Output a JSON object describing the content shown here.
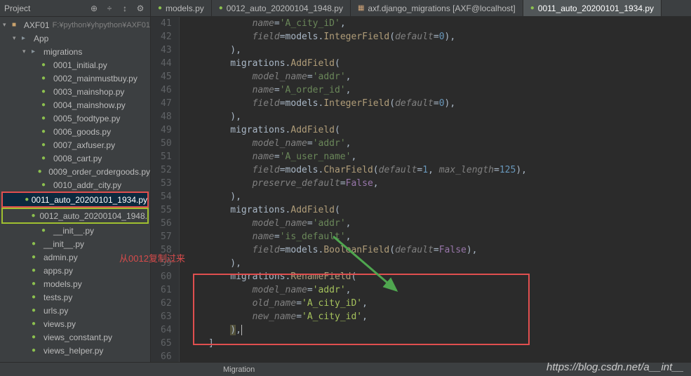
{
  "project_header": {
    "title": "Project",
    "icons": [
      "target",
      "divide",
      "collapse",
      "gear"
    ]
  },
  "tabs": [
    {
      "label": "models.py",
      "type": "py",
      "active": false
    },
    {
      "label": "0012_auto_20200104_1948.py",
      "type": "py",
      "active": false
    },
    {
      "label": "axf.django_migrations [AXF@localhost]",
      "type": "db",
      "active": false
    },
    {
      "label": "0011_auto_20200101_1934.py",
      "type": "py",
      "active": true
    }
  ],
  "tree": {
    "root": {
      "name": "AXF01",
      "path": "F:¥python¥yhpython¥AXF01"
    },
    "nodes": [
      {
        "indent": 0,
        "name": "AXF01",
        "sub": "F:¥python¥yhpython¥AXF01",
        "icon": "module",
        "expanded": true
      },
      {
        "indent": 1,
        "name": "App",
        "icon": "folder",
        "expanded": true
      },
      {
        "indent": 2,
        "name": "migrations",
        "icon": "folder",
        "expanded": true
      },
      {
        "indent": 3,
        "name": "0001_initial.py",
        "icon": "py"
      },
      {
        "indent": 3,
        "name": "0002_mainmustbuy.py",
        "icon": "py"
      },
      {
        "indent": 3,
        "name": "0003_mainshop.py",
        "icon": "py"
      },
      {
        "indent": 3,
        "name": "0004_mainshow.py",
        "icon": "py"
      },
      {
        "indent": 3,
        "name": "0005_foodtype.py",
        "icon": "py"
      },
      {
        "indent": 3,
        "name": "0006_goods.py",
        "icon": "py"
      },
      {
        "indent": 3,
        "name": "0007_axfuser.py",
        "icon": "py"
      },
      {
        "indent": 3,
        "name": "0008_cart.py",
        "icon": "py"
      },
      {
        "indent": 3,
        "name": "0009_order_ordergoods.py",
        "icon": "py"
      },
      {
        "indent": 3,
        "name": "0010_addr_city.py",
        "icon": "py"
      },
      {
        "indent": 3,
        "name": "0011_auto_20200101_1934.py",
        "icon": "py",
        "selected": true,
        "box": "red"
      },
      {
        "indent": 3,
        "name": "0012_auto_20200104_1948.",
        "icon": "py",
        "box": "green"
      },
      {
        "indent": 3,
        "name": "__init__.py",
        "icon": "py"
      },
      {
        "indent": 2,
        "name": "__init__.py",
        "icon": "py"
      },
      {
        "indent": 2,
        "name": "admin.py",
        "icon": "py"
      },
      {
        "indent": 2,
        "name": "apps.py",
        "icon": "py"
      },
      {
        "indent": 2,
        "name": "models.py",
        "icon": "py"
      },
      {
        "indent": 2,
        "name": "tests.py",
        "icon": "py"
      },
      {
        "indent": 2,
        "name": "urls.py",
        "icon": "py"
      },
      {
        "indent": 2,
        "name": "views.py",
        "icon": "py"
      },
      {
        "indent": 2,
        "name": "views_constant.py",
        "icon": "py"
      },
      {
        "indent": 2,
        "name": "views_helper.py",
        "icon": "py"
      }
    ]
  },
  "gutter": {
    "start": 41,
    "end": 66
  },
  "code_lines": [
    {
      "n": 41,
      "html": "            <span class='param'>name</span>=<span class='str'>'A_city_iD'</span>,"
    },
    {
      "n": 42,
      "html": "            <span class='param'>field</span>=models.<span class='fn'>IntegerField</span>(<span class='param'>default</span>=<span class='num'>0</span>),"
    },
    {
      "n": 43,
      "html": "        ),"
    },
    {
      "n": 44,
      "html": "        migrations.<span class='fn'>AddField</span>("
    },
    {
      "n": 45,
      "html": "            <span class='param'>model_name</span>=<span class='str'>'addr'</span>,"
    },
    {
      "n": 46,
      "html": "            <span class='param'>name</span>=<span class='str'>'A_order_id'</span>,"
    },
    {
      "n": 47,
      "html": "            <span class='param'>field</span>=models.<span class='fn'>IntegerField</span>(<span class='param'>default</span>=<span class='num'>0</span>),"
    },
    {
      "n": 48,
      "html": "        ),"
    },
    {
      "n": 49,
      "html": "        migrations.<span class='fn'>AddField</span>("
    },
    {
      "n": 50,
      "html": "            <span class='param'>model_name</span>=<span class='str'>'addr'</span>,"
    },
    {
      "n": 51,
      "html": "            <span class='param'>name</span>=<span class='str'>'A_user_name'</span>,"
    },
    {
      "n": 52,
      "html": "            <span class='param'>field</span>=models.<span class='fn'>CharField</span>(<span class='param'>default</span>=<span class='num'>1</span>, <span class='param'>max_length</span>=<span class='num'>125</span>),"
    },
    {
      "n": 53,
      "html": "            <span class='param'>preserve_default</span>=<span class='const'>False</span>,"
    },
    {
      "n": 54,
      "html": "        ),"
    },
    {
      "n": 55,
      "html": "        migrations.<span class='fn'>AddField</span>("
    },
    {
      "n": 56,
      "html": "            <span class='param'>model_name</span>=<span class='str'>'addr'</span>,"
    },
    {
      "n": 57,
      "html": "            <span class='param'>name</span>=<span class='str'>'is_default'</span>,"
    },
    {
      "n": 58,
      "html": "            <span class='param'>field</span>=models.<span class='fn'>BooleanField</span>(<span class='param'>default</span>=<span class='const'>False</span>),"
    },
    {
      "n": 59,
      "html": "        ),"
    },
    {
      "n": 60,
      "html": "        migrations.<span class='fn'>RenameField</span>("
    },
    {
      "n": 61,
      "html": "            <span class='param'>model_name</span>=<span class='str-alt'>'addr'</span>,"
    },
    {
      "n": 62,
      "html": "            <span class='param'>old_name</span>=<span class='str-alt'>'A_city_iD'</span>,"
    },
    {
      "n": 63,
      "html": "            <span class='param'>new_name</span>=<span class='str-alt'>'A_city_id'</span>,"
    },
    {
      "n": 64,
      "html": "        <span class='warn-bg'>)</span>,<span style='border-left:1px solid #bbb;'> </span>"
    },
    {
      "n": 65,
      "html": "    ]"
    },
    {
      "n": 66,
      "html": ""
    }
  ],
  "annotation": "从0012复制过来",
  "breadcrumb": "Migration",
  "watermark": "https://blog.csdn.net/a__int__"
}
